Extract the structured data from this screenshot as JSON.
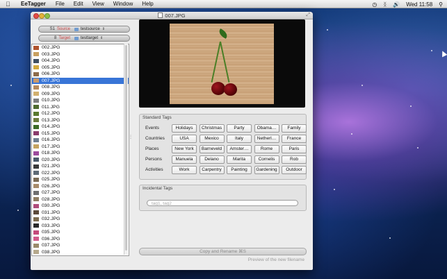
{
  "menubar": {
    "app_name": "EeTagger",
    "items": [
      "File",
      "Edit",
      "View",
      "Window",
      "Help"
    ],
    "clock": "Wed 11:58"
  },
  "window": {
    "title": "007.JPG"
  },
  "folders": {
    "source": {
      "number": "S1",
      "label": "Source",
      "value": "testsource"
    },
    "target": {
      "number": "8",
      "label": "Target",
      "value": "testtarget"
    }
  },
  "files": [
    {
      "name": "002.JPG",
      "thumb": "#b0542e"
    },
    {
      "name": "003.JPG",
      "thumb": "#c8a060"
    },
    {
      "name": "004.JPG",
      "thumb": "#3e4f62"
    },
    {
      "name": "005.JPG",
      "thumb": "#d2a93e"
    },
    {
      "name": "006.JPG",
      "thumb": "#8d6b4a"
    },
    {
      "name": "007.JPG",
      "thumb": "#c99a6c",
      "selected": true
    },
    {
      "name": "008.JPG",
      "thumb": "#b68a5d"
    },
    {
      "name": "009.JPG",
      "thumb": "#d2b06e"
    },
    {
      "name": "010.JPG",
      "thumb": "#7e7e7e"
    },
    {
      "name": "011.JPG",
      "thumb": "#4f6b2e"
    },
    {
      "name": "012.JPG",
      "thumb": "#5a7a2e"
    },
    {
      "name": "013.JPG",
      "thumb": "#6b7b3c"
    },
    {
      "name": "014.JPG",
      "thumb": "#3c6a25"
    },
    {
      "name": "015.JPG",
      "thumb": "#8a3b6b"
    },
    {
      "name": "016.JPG",
      "thumb": "#6f7f90"
    },
    {
      "name": "017.JPG",
      "thumb": "#c5a35f"
    },
    {
      "name": "018.JPG",
      "thumb": "#9c4a9c"
    },
    {
      "name": "020.JPG",
      "thumb": "#4a5a6a"
    },
    {
      "name": "021.JPG",
      "thumb": "#3a3a3a"
    },
    {
      "name": "022.JPG",
      "thumb": "#5e6a75"
    },
    {
      "name": "025.JPG",
      "thumb": "#7a6b55"
    },
    {
      "name": "026.JPG",
      "thumb": "#a88c6a"
    },
    {
      "name": "027.JPG",
      "thumb": "#6e6e6e"
    },
    {
      "name": "028.JPG",
      "thumb": "#8f7d62"
    },
    {
      "name": "030.JPG",
      "thumb": "#b04c7a"
    },
    {
      "name": "031.JPG",
      "thumb": "#5c4a3a"
    },
    {
      "name": "032.JPG",
      "thumb": "#7c6b4e"
    },
    {
      "name": "033.JPG",
      "thumb": "#2a2a2a"
    },
    {
      "name": "035.JPG",
      "thumb": "#c44a7a"
    },
    {
      "name": "036.JPG",
      "thumb": "#d15a8a"
    },
    {
      "name": "037.JPG",
      "thumb": "#9a8a6a"
    },
    {
      "name": "038.JPG",
      "thumb": "#b6a98c"
    }
  ],
  "standard_tags": {
    "title": "Standard Tags",
    "rows": [
      {
        "label": "Events",
        "tags": [
          "Holidays",
          "Christmas",
          "Party",
          "Obama…",
          "Family"
        ]
      },
      {
        "label": "Countries",
        "tags": [
          "USA",
          "Mexico",
          "Italy",
          "Netherl…",
          "France"
        ]
      },
      {
        "label": "Places",
        "tags": [
          "New York",
          "Barneveld",
          "Amster…",
          "Rome",
          "Paris"
        ]
      },
      {
        "label": "Persons",
        "tags": [
          "Manuela",
          "Delano",
          "Marita",
          "Cornelis",
          "Rob"
        ]
      },
      {
        "label": "Activities",
        "tags": [
          "Work",
          "Carpentry",
          "Painting",
          "Gardening",
          "Outdoor"
        ]
      }
    ]
  },
  "incidental_tags": {
    "title": "Incidental Tags",
    "placeholder": "tag1, tag2"
  },
  "copy_button": "Copy and Rename ⌘S",
  "preview_label": "Preview of the new filename"
}
